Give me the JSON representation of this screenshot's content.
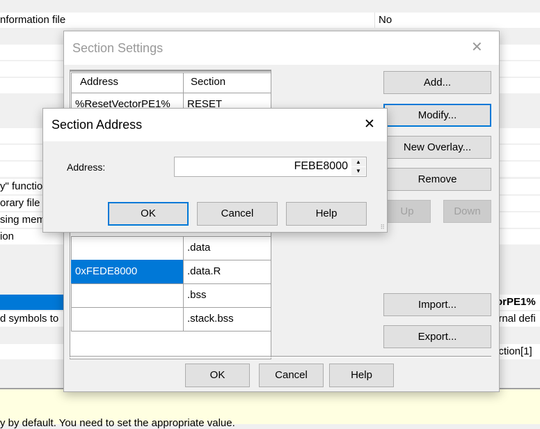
{
  "background": {
    "rows": [
      {
        "left": "nformation file",
        "right": "No"
      },
      {
        "left": "y\" functio",
        "right": ""
      },
      {
        "left": "orary file",
        "right": ""
      },
      {
        "left": "sing mem",
        "right": ""
      },
      {
        "left": "ion",
        "right": ""
      },
      {
        "left": "",
        "right": "torPE1%"
      },
      {
        "left": "d symbols to",
        "right": "ernal defi"
      },
      {
        "left": "",
        "right": "ection[1]"
      }
    ],
    "footer_text": "y by default. You need to set the appropriate value."
  },
  "section_settings": {
    "title": "Section Settings",
    "columns": [
      "Address",
      "Section"
    ],
    "rows": [
      {
        "address": "%ResetVectorPE1%",
        "section": "RESET"
      },
      {
        "address": "",
        "section": ".data"
      },
      {
        "address": "0xFEDE8000",
        "section": ".data.R",
        "selected": true
      },
      {
        "address": "",
        "section": ".bss"
      },
      {
        "address": "",
        "section": ".stack.bss"
      }
    ],
    "buttons": {
      "add": "Add...",
      "modify": "Modify...",
      "new_overlay": "New Overlay...",
      "remove": "Remove",
      "up": "Up",
      "down": "Down",
      "import": "Import...",
      "export": "Export...",
      "ok": "OK",
      "cancel": "Cancel",
      "help": "Help"
    }
  },
  "section_address": {
    "title": "Section Address",
    "address_label": "Address:",
    "address_value": "FEBE8000",
    "buttons": {
      "ok": "OK",
      "cancel": "Cancel",
      "help": "Help"
    }
  },
  "colors": {
    "accent": "#0078d7",
    "footer": "#ffffe1"
  }
}
